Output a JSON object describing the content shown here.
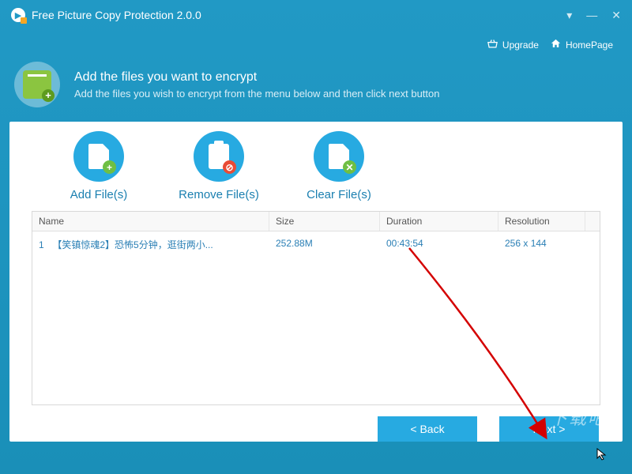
{
  "app": {
    "title": "Free Picture Copy Protection 2.0.0"
  },
  "toolbar": {
    "upgrade": "Upgrade",
    "homepage": "HomePage"
  },
  "header": {
    "title": "Add the files you want to encrypt",
    "subtitle": "Add the files you wish to encrypt from the menu below and then click next button"
  },
  "actions": {
    "add": "Add File(s)",
    "remove": "Remove File(s)",
    "clear": "Clear File(s)"
  },
  "table": {
    "headers": {
      "name": "Name",
      "size": "Size",
      "duration": "Duration",
      "resolution": "Resolution"
    },
    "rows": [
      {
        "index": "1",
        "name": "【笑镇惊魂2】恐怖5分钟，逛街两小...",
        "size": "252.88M",
        "duration": "00:43:54",
        "resolution": "256 x 144"
      }
    ]
  },
  "nav": {
    "back": "< Back",
    "next": "Next >"
  },
  "colors": {
    "brand": "#27aae1",
    "green": "#6fbf44",
    "red": "#e94b35"
  }
}
